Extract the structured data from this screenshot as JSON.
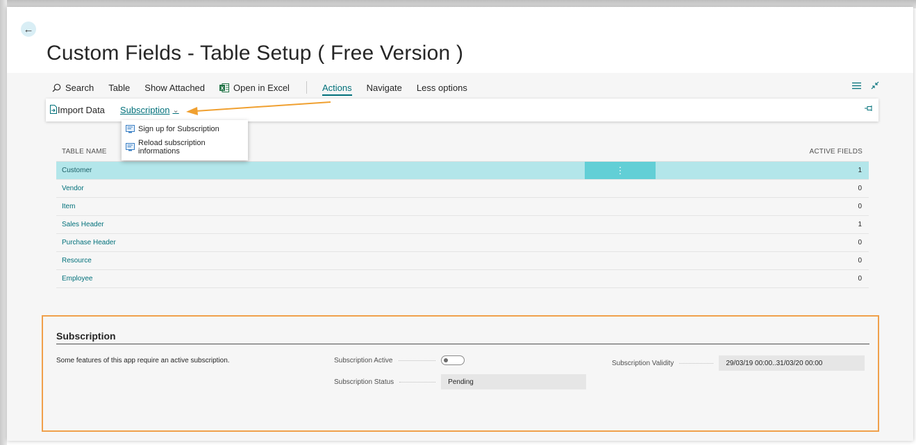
{
  "page": {
    "title": "Custom Fields - Table Setup ( Free Version )",
    "back_icon": "arrow-left-icon"
  },
  "command_bar": {
    "search": "Search",
    "table": "Table",
    "show_attached": "Show Attached",
    "open_in_excel": "Open in Excel",
    "actions": "Actions",
    "navigate": "Navigate",
    "less_options": "Less options"
  },
  "action_bar": {
    "import_data": "Import Data",
    "subscription": "Subscription"
  },
  "dropdown": {
    "items": [
      {
        "label": "Sign up for Subscription"
      },
      {
        "label": "Reload subscription informations"
      }
    ]
  },
  "table": {
    "headers": {
      "name": "TABLE NAME",
      "active": "ACTIVE FIELDS"
    },
    "rows": [
      {
        "name": "Customer",
        "active": "1"
      },
      {
        "name": "Vendor",
        "active": "0"
      },
      {
        "name": "Item",
        "active": "0"
      },
      {
        "name": "Sales Header",
        "active": "1"
      },
      {
        "name": "Purchase Header",
        "active": "0"
      },
      {
        "name": "Resource",
        "active": "0"
      },
      {
        "name": "Employee",
        "active": "0"
      }
    ],
    "selected_row": "Customer"
  },
  "subscription": {
    "title": "Subscription",
    "description": "Some features of this app require an active subscription.",
    "active_label": "Subscription Active",
    "active_value": false,
    "status_label": "Subscription Status",
    "status_value": "Pending",
    "validity_label": "Subscription Validity",
    "validity_value": "29/03/19 00:00..31/03/20 00:00"
  },
  "colors": {
    "accent": "#00707a",
    "selected_row": "#b3e6ea",
    "highlight_border": "#f0a04b",
    "annotation_arrow": "#f0a030"
  }
}
